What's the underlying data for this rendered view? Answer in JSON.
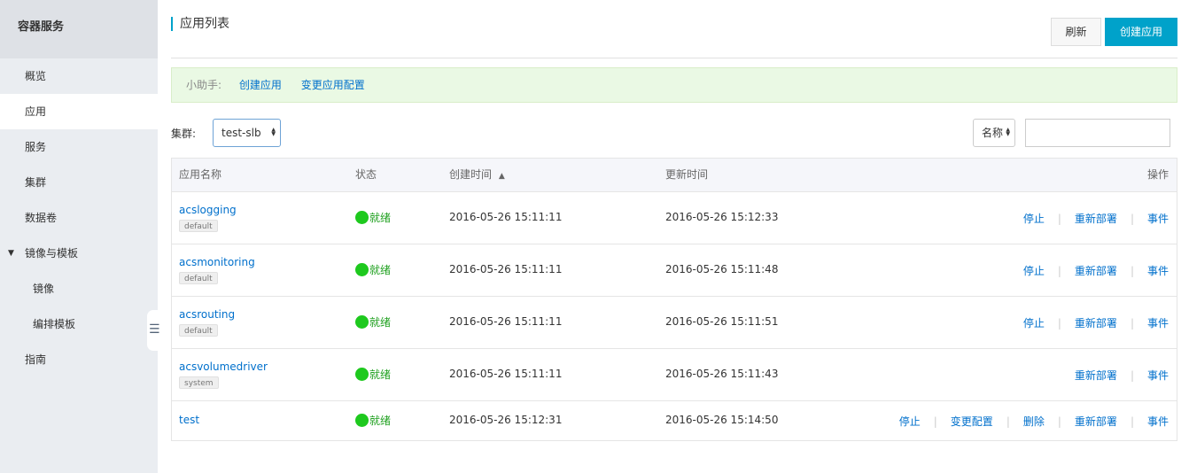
{
  "sidebar": {
    "title": "容器服务",
    "items": [
      {
        "label": "概览"
      },
      {
        "label": "应用"
      },
      {
        "label": "服务"
      },
      {
        "label": "集群"
      },
      {
        "label": "数据卷"
      },
      {
        "label": "镜像与模板"
      },
      {
        "label": "镜像"
      },
      {
        "label": "编排模板"
      },
      {
        "label": "指南"
      }
    ],
    "collapse_glyph": "☰"
  },
  "header": {
    "title": "应用列表",
    "refresh_label": "刷新",
    "create_label": "创建应用"
  },
  "helper": {
    "label": "小助手:",
    "link_create": "创建应用",
    "link_change": "变更应用配置"
  },
  "filter": {
    "cluster_label": "集群:",
    "cluster_value": "test-slb",
    "search_field_value": "名称",
    "search_value": ""
  },
  "table": {
    "headers": {
      "name": "应用名称",
      "status": "状态",
      "created": "创建时间",
      "sort_indicator": "▲",
      "updated": "更新时间",
      "ops": "操作"
    },
    "rows": [
      {
        "name": "acslogging",
        "tag": "default",
        "status": "就绪",
        "created": "2016-05-26 15:11:11",
        "updated": "2016-05-26 15:12:33"
      },
      {
        "name": "acsmonitoring",
        "tag": "default",
        "status": "就绪",
        "created": "2016-05-26 15:11:11",
        "updated": "2016-05-26 15:11:48"
      },
      {
        "name": "acsrouting",
        "tag": "default",
        "status": "就绪",
        "created": "2016-05-26 15:11:11",
        "updated": "2016-05-26 15:11:51"
      },
      {
        "name": "acsvolumedriver",
        "tag": "system",
        "status": "就绪",
        "created": "2016-05-26 15:11:11",
        "updated": "2016-05-26 15:11:43"
      },
      {
        "name": "test",
        "tag": "",
        "status": "就绪",
        "created": "2016-05-26 15:12:31",
        "updated": "2016-05-26 15:14:50"
      }
    ],
    "ops": {
      "stop": "停止",
      "change_config": "变更配置",
      "delete": "删除",
      "redeploy": "重新部署",
      "events": "事件",
      "separator": "|"
    }
  }
}
